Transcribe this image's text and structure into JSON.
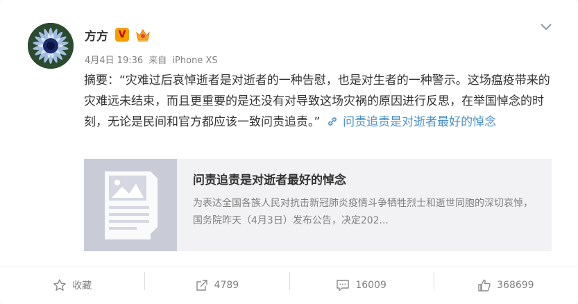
{
  "post": {
    "username": "方方",
    "vip_badge": "V",
    "date": "4月4日 19:36",
    "source_prefix": "来自",
    "source": "iPhone XS",
    "body_text": "摘要：“灾难过后哀悼逝者是对逝者的一种告慰，也是对生者的一种警示。这场瘟疫带来的灾难远未结束，而且更重要的是还没有对导致这场灾祸的原因进行反思，在举国悼念的时刻，无论是民间和官方都应该一致问责追责。”",
    "link_icon": "🔗",
    "link_text": "问责追责是对逝者最好的悼念"
  },
  "preview": {
    "title": "问责追责是对逝者最好的悼念",
    "description": "为表达全国各族人民对抗击新冠肺炎疫情斗争牺牲烈士和逝世同胞的深切哀悼，国务院昨天（4月3日）发布公告，决定202..."
  },
  "actions": {
    "favorite_label": "收藏",
    "repost_count": "4789",
    "comment_count": "16009",
    "like_count": "368699"
  },
  "colors": {
    "link": "#4a90c8",
    "vip_badge_bg": "#f2a100",
    "meta_text": "#808080"
  },
  "icons": {
    "expand": "chevron-down-icon",
    "favorite": "star-icon",
    "repost": "share-arrow-icon",
    "comment": "comment-icon",
    "like": "thumbs-up-icon",
    "link": "link-icon"
  }
}
